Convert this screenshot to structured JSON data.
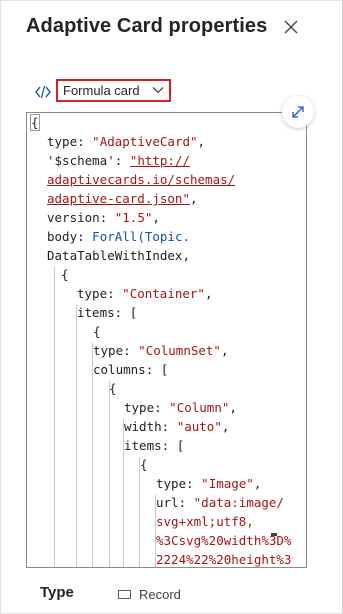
{
  "panel": {
    "title": "Adaptive Card properties"
  },
  "icons": {
    "close": "close-icon",
    "code": "code-icon",
    "chevron": "chevron-down-icon",
    "expand": "expand-icon"
  },
  "card_type": {
    "selected": "Formula card"
  },
  "editor": {
    "lines": [
      [
        "{"
      ],
      [
        "type",
        ": ",
        "\"AdaptiveCard\"",
        ","
      ],
      [
        "'$schema'",
        ": ",
        "\"http://"
      ],
      [
        "adaptivecards.io/schemas/"
      ],
      [
        "adaptive-card.json\"",
        ","
      ],
      [
        "version",
        ": ",
        "\"1.5\"",
        ","
      ],
      [
        "body",
        ": ",
        "ForAll(Topic."
      ],
      [
        "DataTableWithIndex",
        ","
      ],
      [
        "{"
      ],
      [
        "type",
        ": ",
        "\"Container\"",
        ","
      ],
      [
        "items",
        ": ["
      ],
      [
        "{"
      ],
      [
        "type",
        ": ",
        "\"ColumnSet\"",
        ","
      ],
      [
        "columns",
        ": ["
      ],
      [
        "{"
      ],
      [
        "type",
        ": ",
        "\"Column\"",
        ","
      ],
      [
        "width",
        ": ",
        "\"auto\"",
        ","
      ],
      [
        "items",
        ": ["
      ],
      [
        "{"
      ],
      [
        "type",
        ": ",
        "\"Image\"",
        ","
      ],
      [
        "url",
        ": ",
        "\"data:image/"
      ],
      [
        "svg+xml;utf8,"
      ],
      [
        "%3Csvg%20width%3D%"
      ],
      [
        "2224%22%20height%3"
      ]
    ]
  },
  "footer": {
    "type_label": "Type",
    "type_value": "Record"
  },
  "colors": {
    "string": "#a31515",
    "function": "#1a4ea3",
    "highlight_border": "#d1222a"
  }
}
